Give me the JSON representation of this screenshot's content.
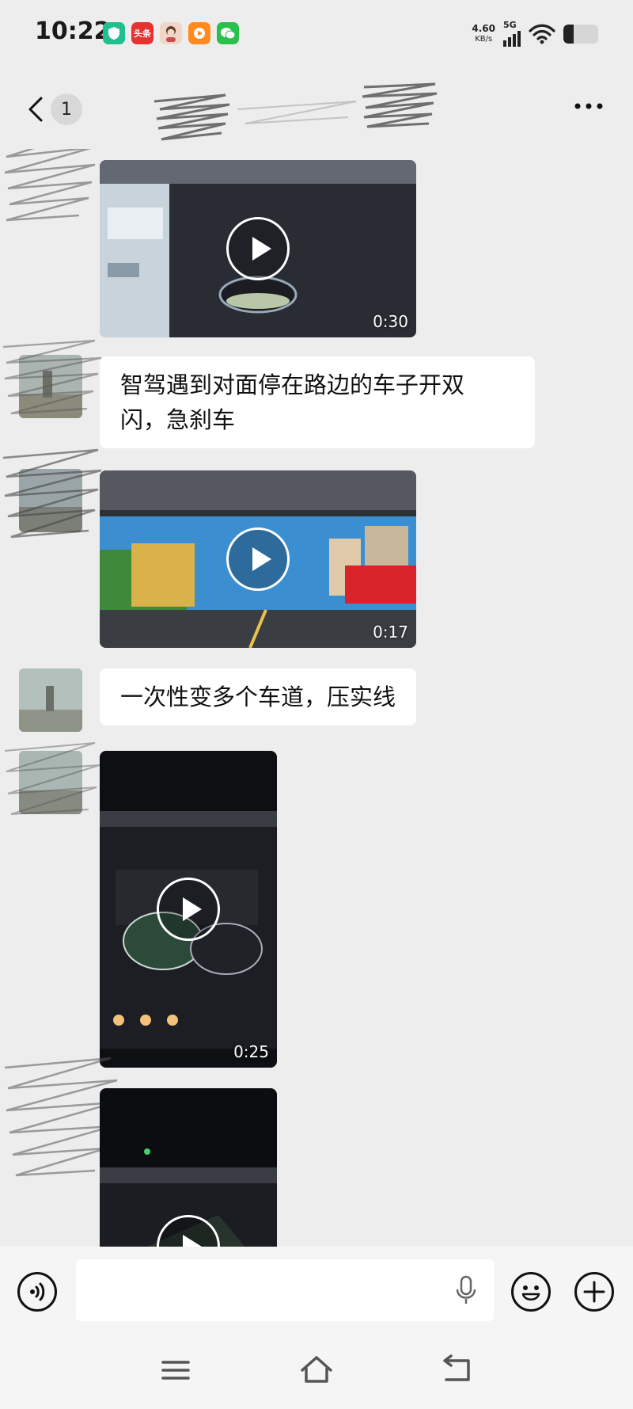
{
  "status_bar": {
    "time": "10:22",
    "net_speed": "4.60",
    "net_speed_unit": "KB/s",
    "network_type": "5G",
    "apps": [
      {
        "name": "security-app-icon",
        "color": "#1fbf8f",
        "label": ""
      },
      {
        "name": "toutiao-app-icon",
        "color": "#e8322f",
        "label": "头条"
      },
      {
        "name": "avatar-app-icon",
        "color": "#f1d6c8",
        "label": ""
      },
      {
        "name": "video-app-icon",
        "color": "#ff8a1f",
        "label": ""
      },
      {
        "name": "wechat-app-icon",
        "color": "#2ac14b",
        "label": ""
      }
    ],
    "battery_level": 0.3
  },
  "header": {
    "unread_count": "1"
  },
  "messages": [
    {
      "type": "video",
      "duration": "0:30"
    },
    {
      "type": "text",
      "text": "智驾遇到对面停在路边的车子开双\n闪，急刹车"
    },
    {
      "type": "video",
      "duration": "0:17"
    },
    {
      "type": "text",
      "text": "一次性变多个车道，压实线"
    },
    {
      "type": "video",
      "duration": "0:25"
    },
    {
      "type": "video",
      "duration": ""
    }
  ],
  "input": {
    "placeholder": ""
  },
  "colors": {
    "background": "#ededed",
    "bubble": "#ffffff",
    "bar": "#f5f5f5"
  }
}
